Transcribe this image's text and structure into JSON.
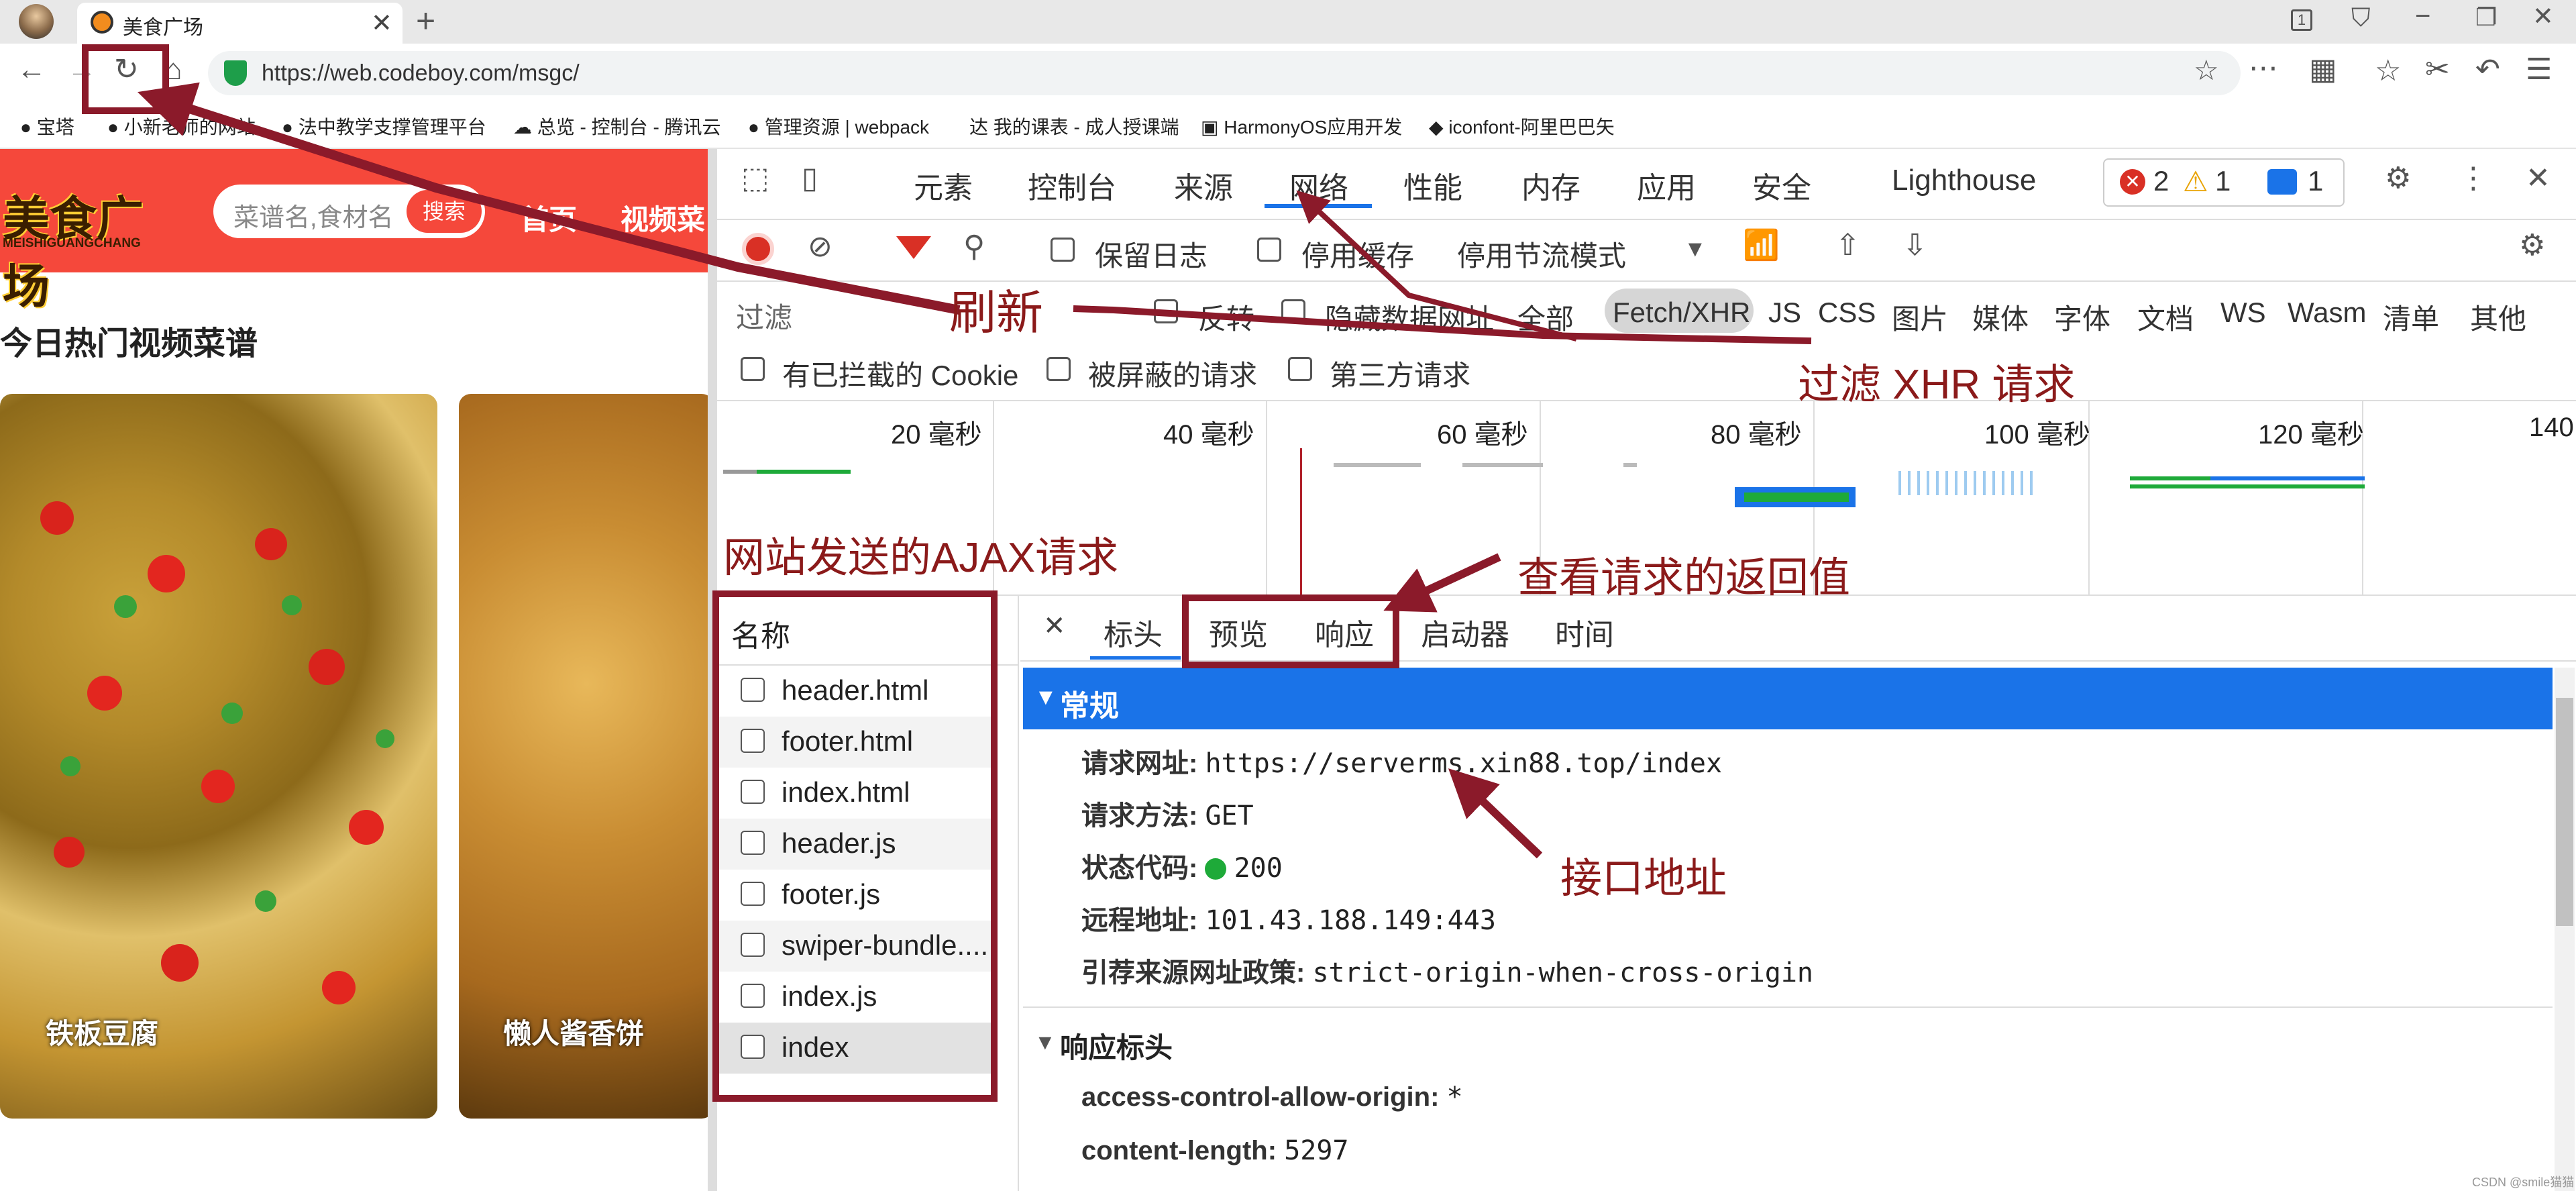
{
  "browser": {
    "tab_title": "美食广场",
    "url": "https://web.codeboy.com/msgc/",
    "bookmarks": [
      "宝塔",
      "小新老师的网站",
      "法中教学支撑管理平台",
      "总览 - 控制台 - 腾讯云",
      "管理资源 | webpack",
      "我的课表 - 成人授课端",
      "HarmonyOS应用开发",
      "iconfont-阿里巴巴矢"
    ]
  },
  "site": {
    "logo_text": "美食广场",
    "logo_sub": "MEISHIGUANGCHANG",
    "search_placeholder": "菜谱名,食材名",
    "search_button": "搜索",
    "nav": [
      "首页",
      "视频菜"
    ],
    "section_title": "今日热门视频菜谱",
    "cards": [
      "铁板豆腐",
      "懒人酱香饼"
    ]
  },
  "devtools": {
    "tabs": [
      "元素",
      "控制台",
      "来源",
      "网络",
      "性能",
      "内存",
      "应用",
      "安全",
      "Lighthouse"
    ],
    "active_tab": "网络",
    "errors": "2",
    "warnings": "1",
    "messages": "1",
    "toolbar": {
      "preserve_log": "保留日志",
      "disable_cache": "停用缓存",
      "throttle": "停用节流模式"
    },
    "filter": {
      "placeholder": "过滤",
      "invert": "反转",
      "hide_data_urls": "隐藏数据网址",
      "types": [
        "全部",
        "Fetch/XHR",
        "JS",
        "CSS",
        "图片",
        "媒体",
        "字体",
        "文档",
        "WS",
        "Wasm",
        "清单",
        "其他"
      ],
      "active_type": "Fetch/XHR"
    },
    "filter2": {
      "blocked_cookies": "有已拦截的 Cookie",
      "blocked_requests": "被屏蔽的请求",
      "third_party": "第三方请求"
    },
    "timeline_ticks": [
      "20 毫秒",
      "40 毫秒",
      "60 毫秒",
      "80 毫秒",
      "100 毫秒",
      "120 毫秒",
      "140"
    ],
    "name_header": "名称",
    "requests": [
      "header.html",
      "footer.html",
      "index.html",
      "header.js",
      "footer.js",
      "swiper-bundle....",
      "index.js",
      "index"
    ],
    "detail_tabs": [
      "标头",
      "预览",
      "响应",
      "启动器",
      "时间"
    ],
    "general": {
      "title": "常规",
      "url_label": "请求网址:",
      "url": "https://serverms.xin88.top/index",
      "method_label": "请求方法:",
      "method": "GET",
      "status_label": "状态代码:",
      "status": "200",
      "remote_label": "远程地址:",
      "remote": "101.43.188.149:443",
      "referrer_label": "引荐来源网址政策:",
      "referrer": "strict-origin-when-cross-origin"
    },
    "response_headers": {
      "title": "响应标头",
      "rows": [
        {
          "k": "access-control-allow-origin:",
          "v": "*"
        },
        {
          "k": "content-length:",
          "v": "5297"
        }
      ]
    }
  },
  "annotations": {
    "refresh": "刷新",
    "filter_xhr": "过滤 XHR 请求",
    "ajax": "网站发送的AJAX请求",
    "view_response": "查看请求的返回值",
    "endpoint": "接口地址"
  },
  "watermark": "CSDN @smile猫猫",
  "colors": {
    "annotation": "#8b1a2a",
    "accent": "#1a73e8",
    "site_red": "#f5483b",
    "status_green": "#1eaa39"
  }
}
